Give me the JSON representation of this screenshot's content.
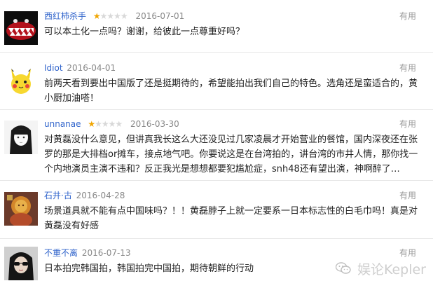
{
  "useful_label": "有用",
  "comments": [
    {
      "user": "西红柿杀手",
      "stars": 1,
      "date": "2016-07-01",
      "text": "可以本土化一点吗？谢谢，给彼此一点尊重好吗？",
      "avatar_icon": "red-monster-avatar-icon"
    },
    {
      "user": "Idiot",
      "stars": 0,
      "date": "2016-04-01",
      "text": "前两天看到要出中国版了还是挺期待的，希望能拍出我们自己的特色。选角还是蛮适合的，黄小厨加油嗒！",
      "avatar_icon": "yellow-pikachu-avatar-icon"
    },
    {
      "user": "unnanae",
      "stars": 1,
      "date": "2016-03-30",
      "text": "对黄磊没什么意见，但讲真我长这么大还没见过几家凌晨才开始营业的餐馆，国内深夜还在张罗的那是大排档or摊车，接点地气吧。你要说这是在台湾拍的，讲台湾的市井人情，那你找一个内地演员主演不违和？反正我光是想想都要犯尴尬症，snh48还有望出演，神啊醉了…",
      "avatar_icon": "sketch-girl-avatar-icon"
    },
    {
      "user": "石井·古",
      "stars": 0,
      "date": "2016-04-28",
      "text": "场景道具就不能有点中国味吗？！！黄磊脖子上就一定要系一日本标志性的白毛巾吗！真是对黄磊没有好感",
      "avatar_icon": "golden-statue-avatar-icon"
    },
    {
      "user": "不重不离",
      "stars": 0,
      "date": "2016-07-13",
      "text": "日本拍完韩国拍，韩国拍完中国拍，期待朝鲜的行动",
      "avatar_icon": "sunglasses-woman-avatar-icon"
    }
  ],
  "watermark": {
    "text": "娱论Kepler",
    "icon": "wechat-icon"
  }
}
